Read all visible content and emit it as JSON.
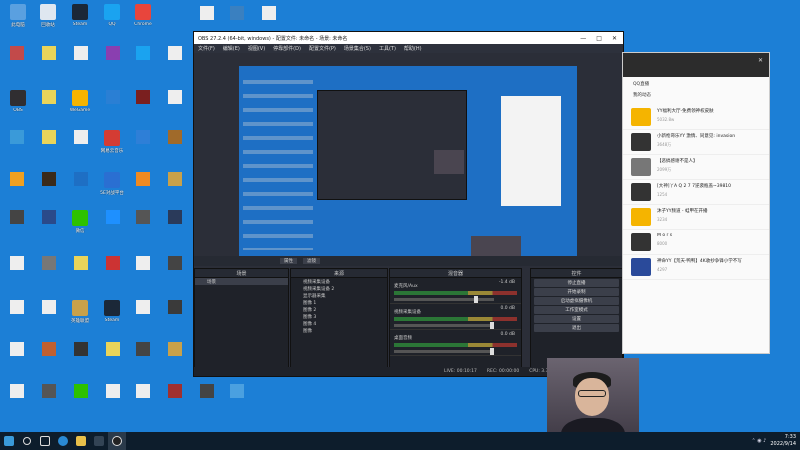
{
  "desktop": {
    "icons": [
      {
        "label": "此电脑",
        "color": "#5aa0e0"
      },
      {
        "label": "回收站",
        "color": "#dfe7f0"
      },
      {
        "label": "Steam",
        "color": "#1b2838"
      },
      {
        "label": "QQ",
        "color": "#1aa3f0"
      },
      {
        "label": "Chrome",
        "color": "#e8453c"
      },
      {
        "label": "OBS",
        "color": "#302e31"
      },
      {
        "label": "WeGame",
        "color": "#f5b400"
      },
      {
        "label": "网易云音乐",
        "color": "#d43c33"
      },
      {
        "label": "微信",
        "color": "#2dc100"
      },
      {
        "label": "英雄联盟",
        "color": "#c8a14a"
      },
      {
        "label": "Steam",
        "color": "#1b2838"
      },
      {
        "label": "5E对战平台",
        "color": "#2a6fd2"
      }
    ]
  },
  "taskbar": {
    "clock_time": "7:33",
    "clock_date": "2022/9/14"
  },
  "obs": {
    "title": "OBS 27.2.4 (64-bit, windows) - 配置文件: 未命名 - 场景: 未命名",
    "menu": [
      "文件(F)",
      "编辑(E)",
      "视图(V)",
      "停靠部件(D)",
      "配置文件(P)",
      "场景集合(S)",
      "工具(T)",
      "帮助(H)"
    ],
    "source_bar": {
      "props_label": "属性",
      "filter_label": "滤镜"
    },
    "docks": {
      "scenes_title": "场景",
      "sources_title": "来源",
      "mixer_title": "混音器",
      "controls_title": "控件"
    },
    "scenes": [
      "场景"
    ],
    "sources": [
      "视频采集设备",
      "视频采集设备 2",
      "显示器采集",
      "图像 1",
      "图像 2",
      "图像 3",
      "图像 4",
      "图像"
    ],
    "mixer": [
      {
        "name": "麦克风/Aux",
        "db": "-1.4 dB"
      },
      {
        "name": "视频采集设备",
        "db": "0.0 dB"
      },
      {
        "name": "桌面音频",
        "db": "0.0 dB"
      }
    ],
    "controls": [
      "停止直播",
      "开始录制",
      "启动虚拟摄像机",
      "工作室模式",
      "设置",
      "退出"
    ],
    "status": {
      "live": "LIVE: 00:10:17",
      "rec": "REC: 00:00:00",
      "cpu": "CPU: 3.3%, 30.00 fps"
    }
  },
  "chat": {
    "tabs": [
      "QQ直播",
      "我的动态"
    ],
    "items": [
      {
        "title": "YY福利大厅-免费领神权皮肤",
        "sub": "5032.8w"
      },
      {
        "title": "小新枪哥乐YY 激情、同意见: invasion",
        "sub": "3648万"
      },
      {
        "title": "【恶搞感谢不是人】",
        "sub": "2099万"
      },
      {
        "title": "[大神]丫A Q 2 7 7逆袭瓶盖~39810",
        "sub": "1254"
      },
      {
        "title": "沐子YY频道 - 蛙甲在开播",
        "sub": "3234"
      },
      {
        "title": "M o r s",
        "sub": "8000"
      },
      {
        "title": "神命YY【荒天·鸭鸭】4K收抄争锋小学不写",
        "sub": "4297"
      }
    ]
  }
}
